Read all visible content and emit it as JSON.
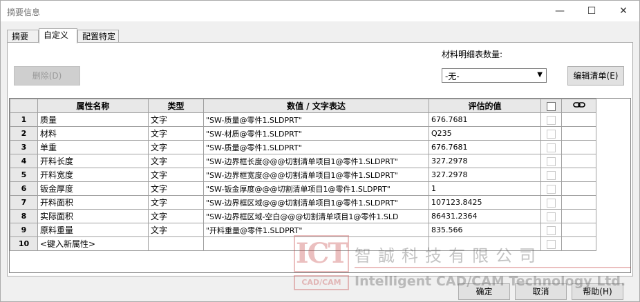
{
  "window": {
    "title": "摘要信息",
    "minimize": "—",
    "maximize": "☐",
    "close": "✕"
  },
  "tabs": [
    {
      "label": "摘要",
      "active": false
    },
    {
      "label": "自定义",
      "active": true
    },
    {
      "label": "配置特定",
      "active": false
    }
  ],
  "toolbar": {
    "delete_label": "删除(D)",
    "bom_qty_label": "材料明细表数量:",
    "bom_qty_value": "-无-",
    "edit_list_label": "编辑清单(E)"
  },
  "grid": {
    "columns": [
      "",
      "属性名称",
      "类型",
      "数值 / 文字表达",
      "评估的值",
      "",
      ""
    ],
    "rows": [
      {
        "num": "1",
        "name": "质量",
        "type": "文字",
        "expr": "\"SW-质量@零件1.SLDPRT\"",
        "value": "676.7681"
      },
      {
        "num": "2",
        "name": "材料",
        "type": "文字",
        "expr": "\"SW-材质@零件1.SLDPRT\"",
        "value": "Q235"
      },
      {
        "num": "3",
        "name": "单重",
        "type": "文字",
        "expr": "\"SW-质量@零件1.SLDPRT\"",
        "value": "676.7681"
      },
      {
        "num": "4",
        "name": "开料长度",
        "type": "文字",
        "expr": "\"SW-边界框长度@@@切割清单项目1@零件1.SLDPRT\"",
        "value": "327.2978"
      },
      {
        "num": "5",
        "name": "开料宽度",
        "type": "文字",
        "expr": "\"SW-边界框宽度@@@切割清单项目1@零件1.SLDPRT\"",
        "value": "327.2978"
      },
      {
        "num": "6",
        "name": "钣金厚度",
        "type": "文字",
        "expr": "\"SW-钣金厚度@@@切割清单项目1@零件1.SLDPRT\"",
        "value": "1"
      },
      {
        "num": "7",
        "name": "开料面积",
        "type": "文字",
        "expr": "\"SW-边界框区域@@@切割清单项目1@零件1.SLDPRT\"",
        "value": "107123.8425"
      },
      {
        "num": "8",
        "name": "实际面积",
        "type": "文字",
        "expr": "\"SW-边界框区域-空白@@@切割清单项目1@零件1.SLD",
        "value": "86431.2364"
      },
      {
        "num": "9",
        "name": "原料重量",
        "type": "文字",
        "expr": "\"开料重量@零件1.SLDPRT\"",
        "value": "835.566"
      },
      {
        "num": "10",
        "name": "<键入新属性>",
        "type": "",
        "expr": "",
        "value": ""
      }
    ]
  },
  "footer": {
    "ok_label": "确定",
    "cancel_label": "取消",
    "help_label": "帮助(H)"
  },
  "watermark": {
    "logo_top": "ICT",
    "logo_bottom": "CAD/CAM",
    "cn_text": "智誠科技有限公司",
    "en_text": "Intelligent CAD/CAM Technology Ltd."
  }
}
